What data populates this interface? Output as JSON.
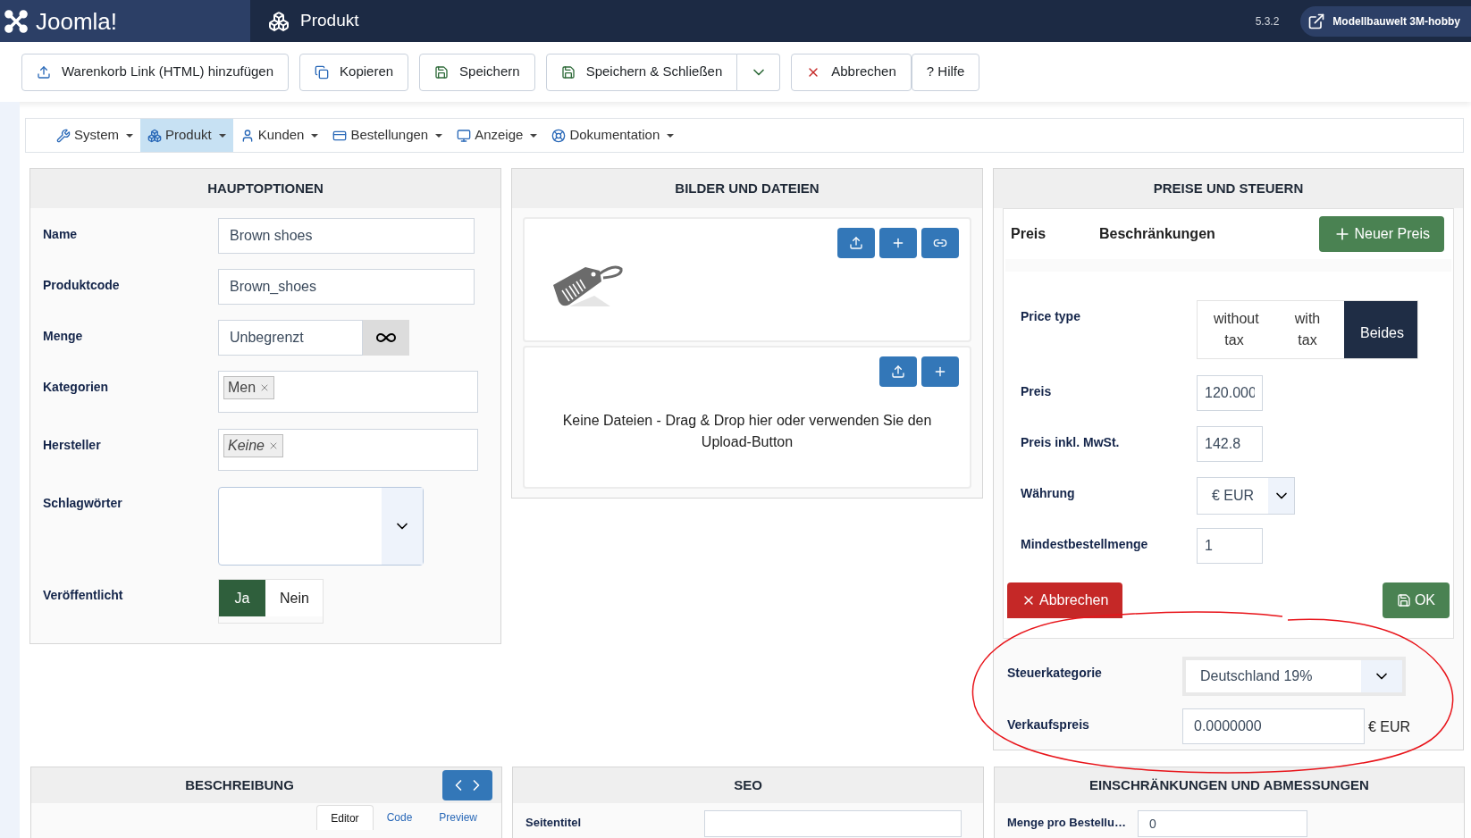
{
  "header": {
    "brand": "Joomla!",
    "page_title": "Produkt",
    "version": "5.3.2",
    "site_link": "Modellbauwelt 3M-hobby"
  },
  "toolbar": [
    {
      "label": "Warenkorb Link (HTML) hinzufügen",
      "kind": "upload"
    },
    {
      "label": "Kopieren",
      "kind": "copy"
    },
    {
      "label": "Speichern",
      "kind": "save"
    },
    {
      "label": "Speichern & Schließen",
      "kind": "save-split"
    },
    {
      "label": "Abbrechen",
      "kind": "cancel"
    },
    {
      "label": "? Hilfe",
      "kind": "plain"
    }
  ],
  "menu": [
    {
      "label": "System",
      "kind": "wrench",
      "selected": false
    },
    {
      "label": "Produkt",
      "kind": "boxes",
      "selected": true
    },
    {
      "label": "Kunden",
      "kind": "user",
      "selected": false
    },
    {
      "label": "Bestellungen",
      "kind": "card",
      "selected": false
    },
    {
      "label": "Anzeige",
      "kind": "monitor",
      "selected": false
    },
    {
      "label": "Dokumentation",
      "kind": "lifebuoy",
      "selected": false
    }
  ],
  "main_options": {
    "title": "HAUPTOPTIONEN",
    "fields": [
      {
        "label": "Name",
        "kind": "text",
        "value": "Brown shoes"
      },
      {
        "label": "Produktcode",
        "kind": "text",
        "value": "Brown_shoes"
      },
      {
        "label": "Menge",
        "kind": "unlimited",
        "value": "Unbegrenzt"
      },
      {
        "label": "Kategorien",
        "kind": "tags",
        "tags": [
          {
            "text": "Men",
            "italic": false
          }
        ]
      },
      {
        "label": "Hersteller",
        "kind": "tags",
        "tags": [
          {
            "text": "Keine",
            "italic": true
          }
        ]
      },
      {
        "label": "Schlagwörter",
        "kind": "multiselect"
      },
      {
        "label": "Veröffentlicht",
        "kind": "toggle",
        "options": [
          {
            "label": "Ja",
            "selected": true
          },
          {
            "label": "Nein",
            "selected": false
          }
        ]
      }
    ]
  },
  "media": {
    "title": "BILDER UND DATEIEN",
    "image_buttons": [
      {
        "kind": "upload"
      },
      {
        "kind": "add"
      },
      {
        "kind": "link"
      }
    ],
    "file_buttons": [
      {
        "kind": "upload"
      },
      {
        "kind": "add"
      }
    ],
    "files_empty_text": "Keine Dateien - Drag & Drop hier oder verwenden Sie den Upload-Button"
  },
  "prices": {
    "title": "PREISE UND STEUERN",
    "tabs": [
      "Preis",
      "Beschränkungen"
    ],
    "new_price_button": "Neuer Preis",
    "price_type": {
      "label": "Price type",
      "options": [
        {
          "label": "without tax",
          "selected": false
        },
        {
          "label": "with tax",
          "selected": false
        },
        {
          "label": "Beides",
          "selected": true
        }
      ]
    },
    "fields": [
      {
        "label": "Preis",
        "kind": "text",
        "value": "120.000"
      },
      {
        "label": "Preis inkl. MwSt.",
        "kind": "text",
        "value": "142.8"
      },
      {
        "label": "Währung",
        "kind": "select",
        "value": "€ EUR"
      },
      {
        "label": "Mindestbestellmenge",
        "kind": "text",
        "value": "1"
      }
    ],
    "cancel_button": "Abbrechen",
    "ok_button": "OK",
    "tax_category": {
      "label": "Steuerkategorie",
      "value": "Deutschland 19%"
    },
    "sale_price": {
      "label": "Verkaufspreis",
      "value": "0.0000000",
      "unit": "€ EUR"
    }
  },
  "description": {
    "title": "BESCHREIBUNG",
    "tabs": [
      {
        "label": "Editor",
        "selected": true
      },
      {
        "label": "Code",
        "selected": false
      },
      {
        "label": "Preview",
        "selected": false
      }
    ]
  },
  "seo": {
    "title": "SEO",
    "field_label": "Seitentitel"
  },
  "limits": {
    "title": "EINSCHRÄNKUNGEN UND ABMESSUNGEN",
    "field_label": "Menge pro Bestellu…",
    "field_value": "0"
  }
}
